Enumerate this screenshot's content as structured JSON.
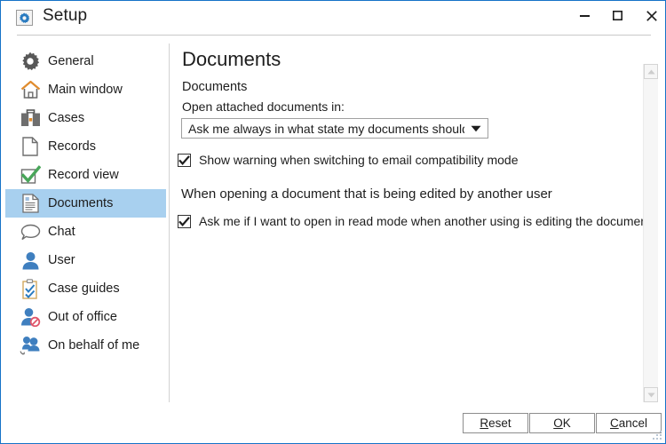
{
  "window": {
    "title": "Setup",
    "icon": "gear-icon",
    "border_color": "#1673c8",
    "controls": {
      "minimize": "minimize-icon",
      "maximize": "maximize-icon",
      "close": "close-icon"
    }
  },
  "sidebar": {
    "selected_index": 5,
    "highlight_color": "#a8d0ef",
    "items": [
      {
        "label": "General",
        "icon": "gear-icon"
      },
      {
        "label": "Main window",
        "icon": "home-icon"
      },
      {
        "label": "Cases",
        "icon": "briefcase-icon"
      },
      {
        "label": "Records",
        "icon": "page-icon"
      },
      {
        "label": "Record view",
        "icon": "green-check-box-icon"
      },
      {
        "label": "Documents",
        "icon": "document-text-icon"
      },
      {
        "label": "Chat",
        "icon": "speech-bubble-icon"
      },
      {
        "label": "User",
        "icon": "person-icon"
      },
      {
        "label": "Case guides",
        "icon": "clipboard-check-icon"
      },
      {
        "label": "Out of office",
        "icon": "person-blocked-icon"
      },
      {
        "label": "On behalf of me",
        "icon": "people-swap-icon"
      }
    ]
  },
  "content": {
    "page_title": "Documents",
    "group_label": "Documents",
    "combo": {
      "label": "Open attached documents in:",
      "value": "Ask me always in what state my documents should open in",
      "arrow_icon": "chevron-down-icon"
    },
    "checkbox_1": {
      "label": "Show warning when switching to email compatibility mode",
      "checked": true
    },
    "section_heading": "When opening a document that is being edited by another user",
    "checkbox_2": {
      "label": "Ask me if I want to open in read mode when another using is editing the document",
      "checked": true
    }
  },
  "scrollbar": {
    "up_icon": "triangle-up-icon",
    "down_icon": "triangle-down-icon"
  },
  "footer": {
    "reset": {
      "pre": "R",
      "accel": "",
      "post": "eset",
      "label": "Reset"
    },
    "ok": {
      "label": "OK"
    },
    "cancel": {
      "label": "Cancel"
    }
  }
}
